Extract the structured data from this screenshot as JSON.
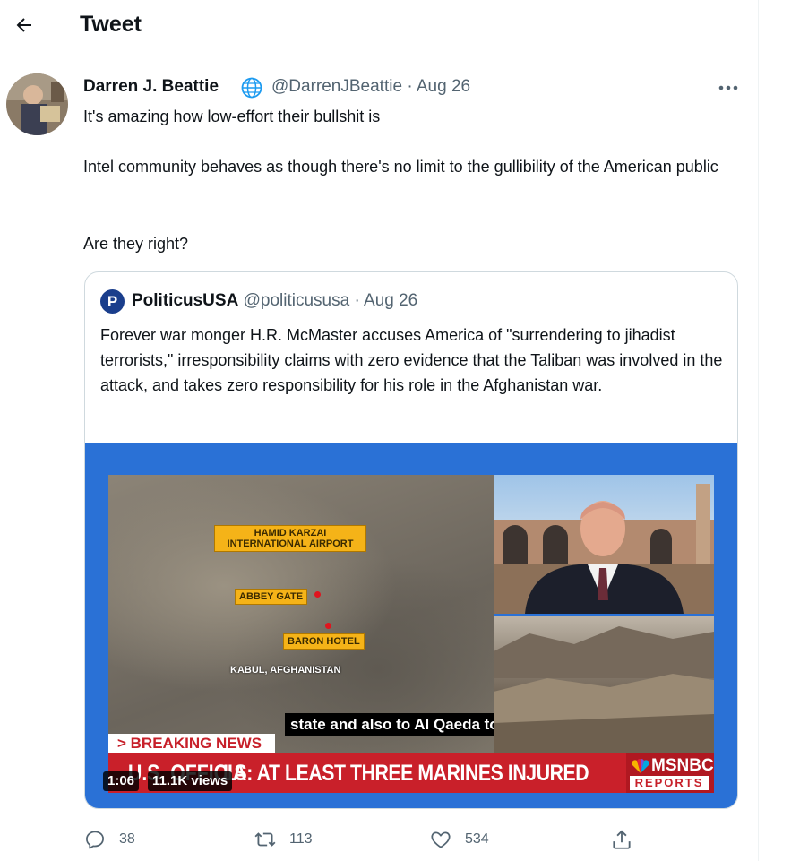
{
  "header": {
    "title": "Tweet",
    "back_icon": "arrow-left-icon"
  },
  "tweet": {
    "author_name": "Darren J. Beattie",
    "verified_icon": "globe-icon",
    "handle": "@DarrenJBeattie",
    "separator": "·",
    "date": "Aug 26",
    "more_icon": "more-horizontal-icon",
    "paragraphs": [
      "It's amazing how low-effort their bullshit is",
      "Intel community behaves as though there's no limit to the gullibility of the American public",
      "Are they right?"
    ]
  },
  "quote": {
    "logo_letter": "P",
    "author_name": "PoliticusUSA",
    "handle": "@politicususa",
    "separator": "·",
    "date": "Aug 26",
    "text": "Forever war monger H.R. McMaster accuses America of \"surrendering to jihadist terrorists,\" irresponsibility claims with zero evidence that the Taliban was involved in the attack, and takes zero responsibility for his role in the Afghanistan war.",
    "video": {
      "map_labels": [
        "HAMID KARZAI INTERNATIONAL AIRPORT",
        "ABBEY GATE",
        "BARON HOTEL"
      ],
      "map_caption": "KABUL, AFGHANISTAN",
      "subtitle": "state and also to Al Qaeda to.",
      "breaking": "> BREAKING NEWS",
      "ticker_left": "U.S. OFFICIA",
      "ticker": "LS: AT LEAST THREE MARINES INJURED",
      "network": "MSNBC",
      "network_sub": "REPORTS",
      "duration": "1:06",
      "views": "11.1K views"
    }
  },
  "actions": {
    "reply": {
      "icon": "reply-icon",
      "count": "38"
    },
    "retweet": {
      "icon": "retweet-icon",
      "count": "113"
    },
    "like": {
      "icon": "heart-icon",
      "count": "534"
    },
    "share": {
      "icon": "share-icon"
    }
  },
  "colors": {
    "text": "#0f1419",
    "muted": "#536471",
    "border": "#cfd9de",
    "msnbc_red": "#c9202a",
    "video_bg": "#2a71d6"
  }
}
